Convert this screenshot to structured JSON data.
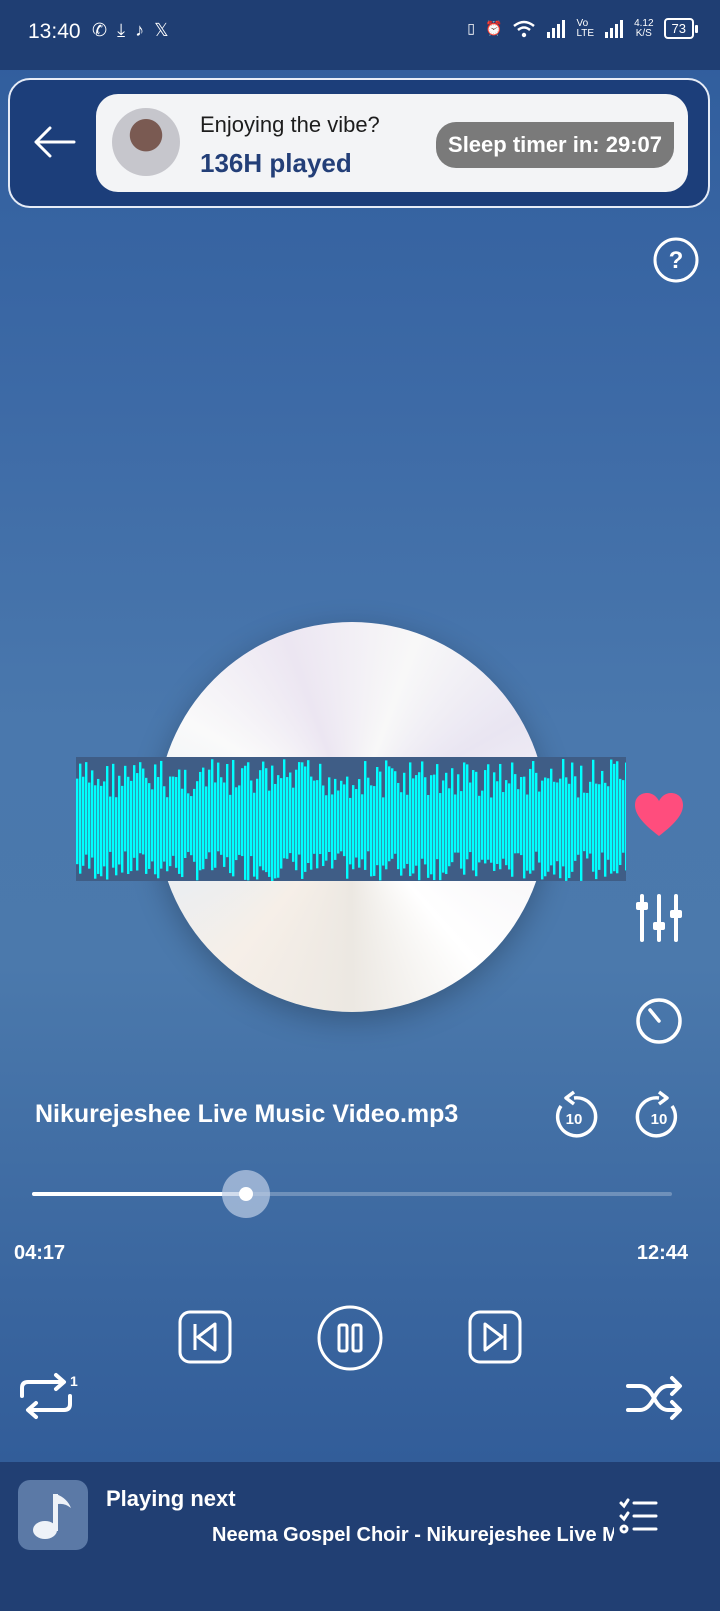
{
  "status_bar": {
    "time": "13:40",
    "left_icons": [
      "whatsapp-icon",
      "download-icon",
      "tiktok-icon",
      "x-icon"
    ],
    "right_icons": [
      "vibrate-icon",
      "alarm-icon",
      "wifi-icon",
      "signal-icon",
      "volte-icon",
      "signal-icon"
    ],
    "net_speed_value": "4.12",
    "net_speed_unit": "K/S",
    "battery": "73"
  },
  "header": {
    "greeting": "Enjoying the vibe?",
    "played": "136H played",
    "sleep_timer": "Sleep timer in: 29:07"
  },
  "player": {
    "track_title": "Nikurejeshee Live Music Video.mp3",
    "elapsed": "04:17",
    "total": "12:44",
    "progress_fraction": 0.335,
    "liked": true,
    "rewind_seconds": "10",
    "forward_seconds": "10",
    "repeat_mode": "1"
  },
  "colors": {
    "accent_heart": "#ff4d7d",
    "visualizer": "#00ffff",
    "bottom_bar": "#213f73",
    "status_bar": "#1f3e73"
  },
  "next_up": {
    "label": "Playing next",
    "track": "Neema Gospel Choir - Nikurejeshee Live Mu"
  }
}
